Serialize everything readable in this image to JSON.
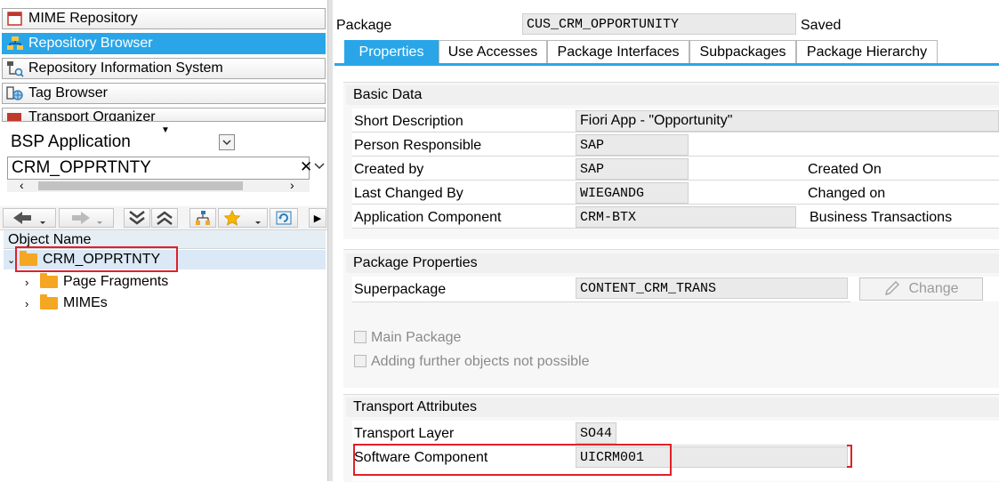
{
  "nav": [
    {
      "label": "MIME Repository",
      "icon": "mime-repository-icon",
      "active": false
    },
    {
      "label": "Repository Browser",
      "icon": "repository-browser-icon",
      "active": true
    },
    {
      "label": "Repository Information System",
      "icon": "repository-info-icon",
      "active": false
    },
    {
      "label": "Tag Browser",
      "icon": "tag-browser-icon",
      "active": false
    },
    {
      "label": "Transport Organizer",
      "icon": "transport-organizer-icon",
      "active": false
    }
  ],
  "object_type": {
    "value": "BSP Application"
  },
  "object_input": {
    "value": "CRM_OPPRTNTY",
    "clear_glyph": "✕"
  },
  "tree": {
    "header": "Object Name",
    "root": "CRM_OPPRTNTY",
    "children": [
      "Page Fragments",
      "MIMEs"
    ]
  },
  "package": {
    "label": "Package",
    "value": "CUS_CRM_OPPORTUNITY",
    "status": "Saved"
  },
  "tabs": [
    "Properties",
    "Use Accesses",
    "Package Interfaces",
    "Subpackages",
    "Package Hierarchy"
  ],
  "basic_data": {
    "title": "Basic Data",
    "short_description_label": "Short Description",
    "short_description": "Fiori App - \"Opportunity\"",
    "person_responsible_label": "Person Responsible",
    "person_responsible": "SAP",
    "created_by_label": "Created by",
    "created_by": "SAP",
    "created_on_label": "Created On",
    "last_changed_by_label": "Last Changed By",
    "last_changed_by": "WIEGANDG",
    "changed_on_label": "Changed on",
    "application_component_label": "Application Component",
    "application_component": "CRM-BTX",
    "application_component_desc": "Business Transactions"
  },
  "package_properties": {
    "title": "Package Properties",
    "superpackage_label": "Superpackage",
    "superpackage": "CONTENT_CRM_TRANS",
    "change_label": "Change",
    "main_package_label": "Main Package",
    "adding_label": "Adding further objects not possible"
  },
  "transport": {
    "title": "Transport Attributes",
    "layer_label": "Transport Layer",
    "layer": "SO44",
    "software_component_label": "Software Component",
    "software_component": "UICRM001"
  },
  "colors": {
    "accent": "#2aa6e8",
    "highlight": "#e0202a"
  }
}
